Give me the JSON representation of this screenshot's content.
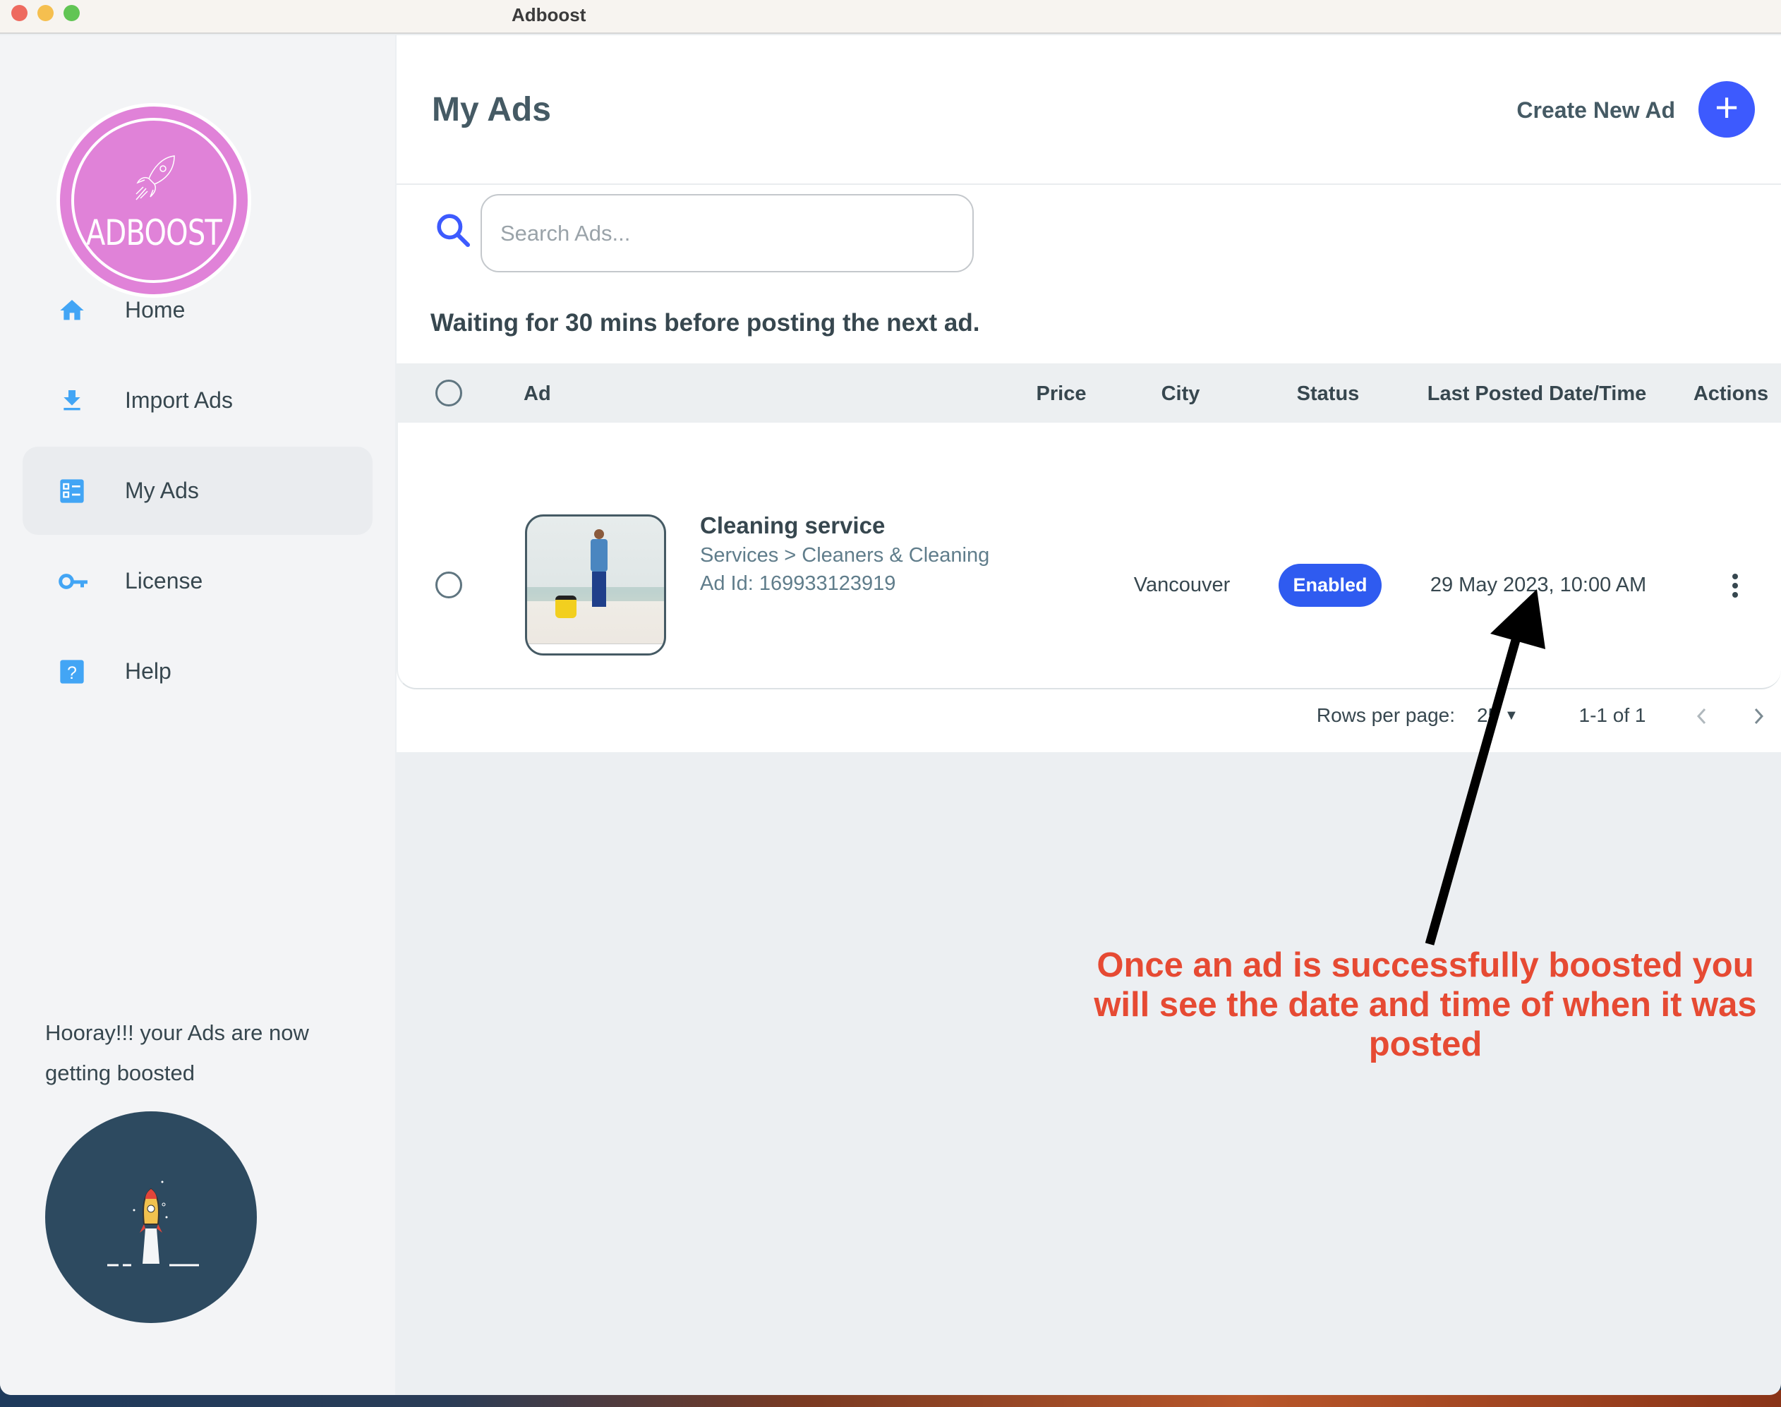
{
  "window": {
    "title": "Adboost"
  },
  "sidebar": {
    "logo_text": "ADBOOST",
    "items": [
      {
        "label": "Home",
        "icon": "home-icon"
      },
      {
        "label": "Import Ads",
        "icon": "download-icon"
      },
      {
        "label": "My Ads",
        "icon": "dashboard-icon",
        "active": true
      },
      {
        "label": "License",
        "icon": "key-icon"
      },
      {
        "label": "Help",
        "icon": "help-icon"
      }
    ],
    "promo_text": "Hooray!!! your Ads are now getting boosted"
  },
  "header": {
    "title": "My Ads",
    "create_label": "Create New Ad",
    "create_icon": "plus-icon"
  },
  "search": {
    "placeholder": "Search Ads..."
  },
  "notice": "Waiting for 30 mins before posting the next ad.",
  "table": {
    "columns": [
      "Ad",
      "Price",
      "City",
      "Status",
      "Last Posted Date/Time",
      "Actions"
    ],
    "rows": [
      {
        "title": "Cleaning service",
        "category": "Services > Cleaners & Cleaning",
        "ad_id": "Ad Id: 169933123919",
        "price": "",
        "city": "Vancouver",
        "status": "Enabled",
        "last_posted": "29 May 2023, 10:00 AM"
      }
    ]
  },
  "pagination": {
    "rows_per_page_label": "Rows per page:",
    "rows_per_page": "25",
    "range": "1-1 of 1"
  },
  "annotation": {
    "text": "Once an ad is successfully boosted you will see the date and time of when it was posted",
    "color": "#e64a33"
  },
  "colors": {
    "accent": "#3d5afe",
    "status_enabled": "#2f5bf0",
    "logo": "#e082d8",
    "nav_icon": "#42a5f5"
  }
}
